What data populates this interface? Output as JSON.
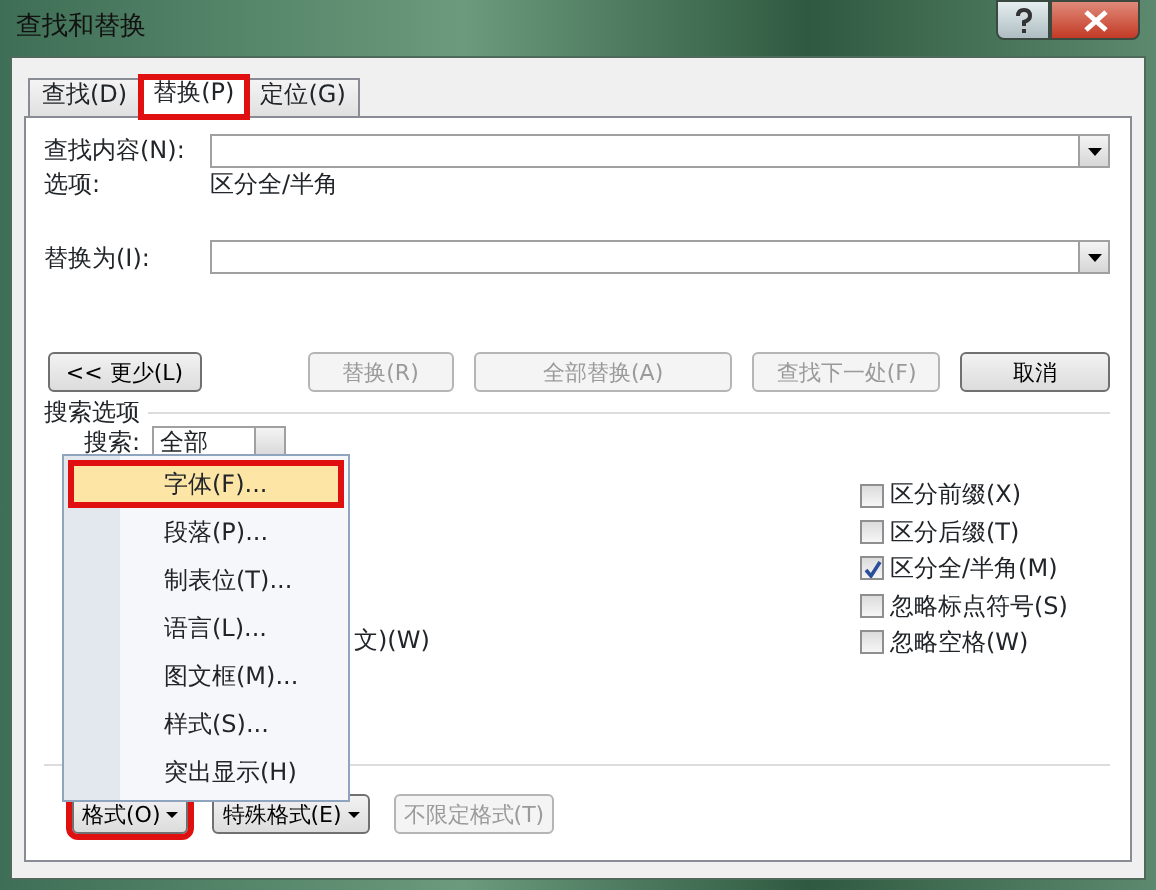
{
  "window": {
    "title": "查找和替换"
  },
  "tabs": [
    {
      "label": "查找(D)",
      "selected": false,
      "marked": false
    },
    {
      "label": "替换(P)",
      "selected": true,
      "marked": true
    },
    {
      "label": "定位(G)",
      "selected": false,
      "marked": false
    }
  ],
  "find": {
    "label": "查找内容(N):",
    "options_label": "选项:",
    "options_value": "区分全/半角"
  },
  "replace": {
    "label": "替换为(I):"
  },
  "buttons": [
    {
      "label": "<< 更少(L)",
      "disabled": false
    },
    {
      "label": "替换(R)",
      "disabled": true
    },
    {
      "label": "全部替换(A)",
      "disabled": true
    },
    {
      "label": "查找下一处(F)",
      "disabled": true
    },
    {
      "label": "取消",
      "disabled": false
    }
  ],
  "search_options": {
    "title": "搜索选项",
    "search_label": "搜索:",
    "search_value": "全部",
    "partial_option": "文)(W)",
    "checkboxes": [
      {
        "label": "区分前缀(X)",
        "checked": false
      },
      {
        "label": "区分后缀(T)",
        "checked": false
      },
      {
        "label": "区分全/半角(M)",
        "checked": true
      },
      {
        "label": "忽略标点符号(S)",
        "checked": false
      },
      {
        "label": "忽略空格(W)",
        "checked": false
      }
    ]
  },
  "bottom_buttons": [
    {
      "label": "格式(O)",
      "dropdown": true,
      "disabled": false,
      "marked": true
    },
    {
      "label": "特殊格式(E)",
      "dropdown": true,
      "disabled": false,
      "marked": false
    },
    {
      "label": "不限定格式(T)",
      "dropdown": false,
      "disabled": true,
      "marked": false
    }
  ],
  "menu": {
    "items": [
      {
        "label": "字体(F)...",
        "selected": true,
        "marked": true
      },
      {
        "label": "段落(P)...",
        "selected": false,
        "marked": false
      },
      {
        "label": "制表位(T)...",
        "selected": false,
        "marked": false
      },
      {
        "label": "语言(L)...",
        "selected": false,
        "marked": false
      },
      {
        "label": "图文框(M)...",
        "selected": false,
        "marked": false
      },
      {
        "label": "样式(S)...",
        "selected": false,
        "marked": false
      },
      {
        "label": "突出显示(H)",
        "selected": false,
        "marked": false
      }
    ]
  }
}
